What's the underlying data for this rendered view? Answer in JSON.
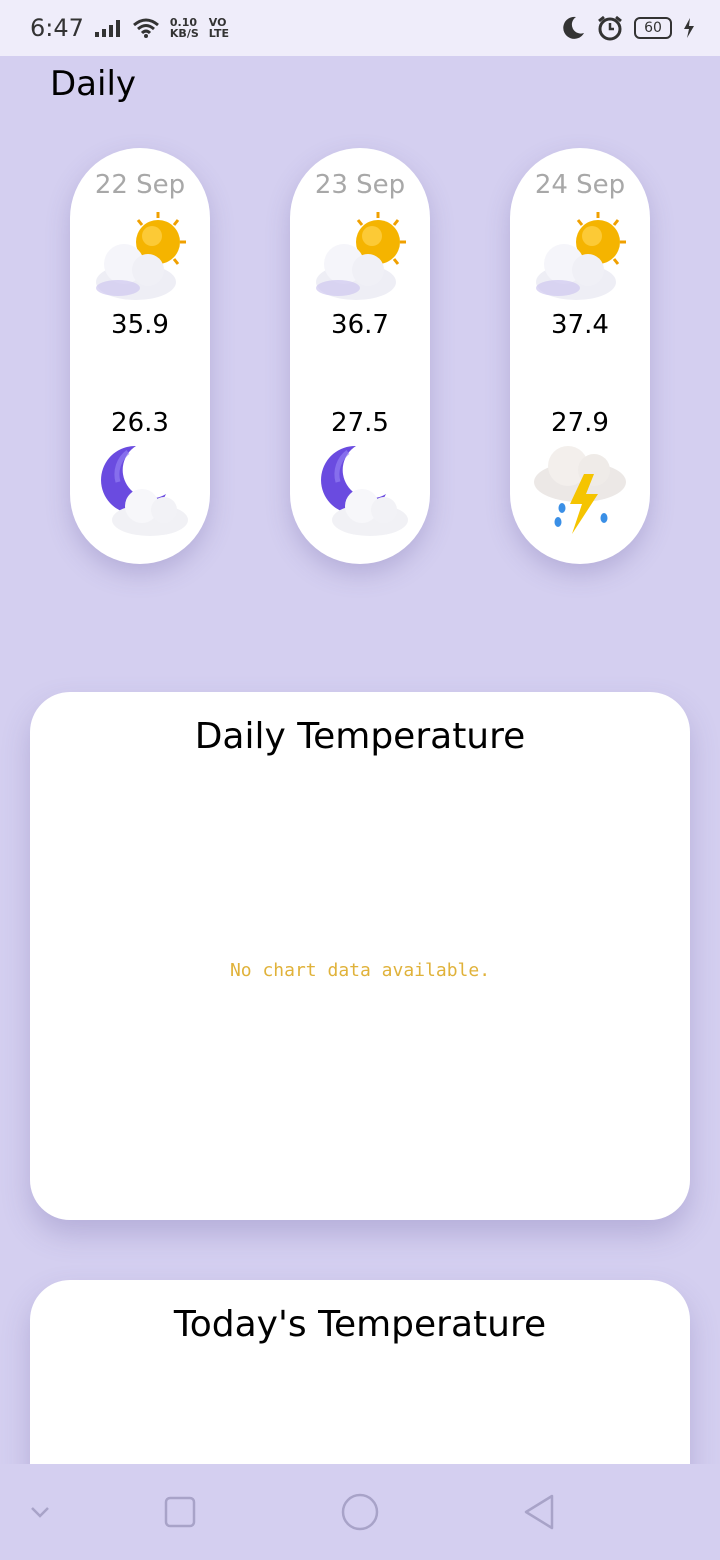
{
  "status_bar": {
    "time": "6:47",
    "net_speed_value": "0.10",
    "net_speed_unit": "KB/S",
    "volte_top": "VO",
    "volte_bottom": "LTE",
    "battery": "60"
  },
  "section_title": "Daily",
  "days": [
    {
      "date": "22 Sep",
      "high": "35.9",
      "low": "26.3",
      "day_icon": "partly-cloudy-sun-icon",
      "night_icon": "moon-cloud-icon"
    },
    {
      "date": "23 Sep",
      "high": "36.7",
      "low": "27.5",
      "day_icon": "partly-cloudy-sun-icon",
      "night_icon": "moon-cloud-icon"
    },
    {
      "date": "24 Sep",
      "high": "37.4",
      "low": "27.9",
      "day_icon": "partly-cloudy-sun-icon",
      "night_icon": "thunderstorm-icon"
    }
  ],
  "daily_chart": {
    "title": "Daily Temperature",
    "empty_message": "No chart data available."
  },
  "today_chart": {
    "title": "Today's Temperature"
  },
  "colors": {
    "background": "#d4cff0",
    "card": "#ffffff",
    "date_text": "#a8a8a8",
    "empty_message": "#e0b23a",
    "sun": "#f5b400",
    "moon": "#6a4be0"
  }
}
